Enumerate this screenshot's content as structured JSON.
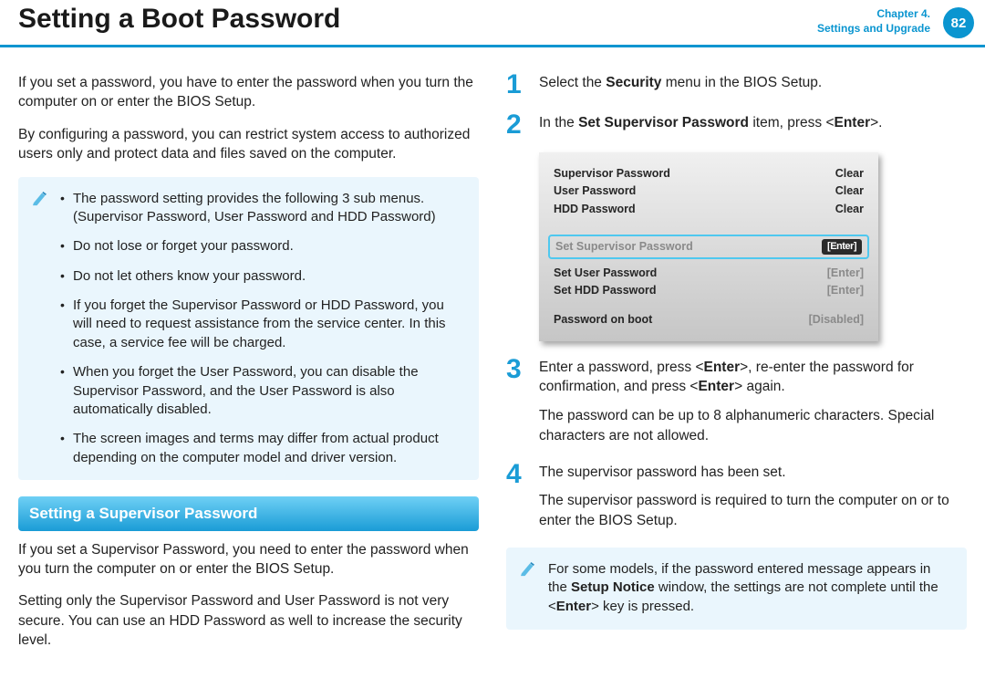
{
  "header": {
    "title": "Setting a Boot Password",
    "chapter_line1": "Chapter 4.",
    "chapter_line2": "Settings and Upgrade",
    "page_number": "82"
  },
  "left": {
    "p1": "If you set a password, you have to enter the password when you turn the computer on or enter the BIOS Setup.",
    "p2": "By configuring a password, you can restrict system access to authorized users only and protect data and files saved on the computer.",
    "notes": [
      "The password setting provides the following 3 sub menus. (Supervisor Password, User Password and HDD Password)",
      "Do not lose or forget your password.",
      "Do not let others know your password.",
      "If you forget the Supervisor Password or HDD Password, you will need to request assistance from the service center. In this case, a service fee will be charged.",
      "When you forget the User Password, you can disable the Supervisor Password, and the User Password is also automatically disabled.",
      "The screen images and terms may differ from actual product depending on the computer model and driver version."
    ],
    "section_title": "Setting a Supervisor Password",
    "p3": "If you set a Supervisor Password, you need to enter the password when you turn the computer on or enter the BIOS Setup.",
    "p4": "Setting only the Supervisor Password and User Password is not very secure. You can use an HDD Password as well to increase the security level."
  },
  "right": {
    "step1": {
      "num": "1",
      "pre": "Select the ",
      "bold": "Security",
      "post": " menu in the BIOS Setup."
    },
    "step2": {
      "num": "2",
      "pre": "In the ",
      "bold": "Set Supervisor Password",
      "mid": " item, press <",
      "enter": "Enter",
      "post": ">."
    },
    "bios": {
      "rows_top": [
        {
          "label": "Supervisor Password",
          "value": "Clear"
        },
        {
          "label": "User Password",
          "value": "Clear"
        },
        {
          "label": "HDD Password",
          "value": "Clear"
        }
      ],
      "highlight": {
        "label": "Set Supervisor Password",
        "value": "[Enter]"
      },
      "rows_mid": [
        {
          "label": "Set User Password",
          "value": "[Enter]"
        },
        {
          "label": "Set HDD Password",
          "value": "[Enter]"
        }
      ],
      "row_bottom": {
        "label": "Password on boot",
        "value": "[Disabled]"
      }
    },
    "step3": {
      "num": "3",
      "t1a": "Enter a password, press <",
      "t1b": "Enter",
      "t1c": ">, re-enter the password for confirmation, and press <",
      "t1d": "Enter",
      "t1e": "> again.",
      "t2": "The password can be up to 8 alphanumeric characters. Special characters are not allowed."
    },
    "step4": {
      "num": "4",
      "t1": "The supervisor password has been set.",
      "t2": "The supervisor password is required to turn the computer on or to enter the BIOS Setup."
    },
    "footnote": {
      "a": "For some models, if the password entered message appears in the ",
      "b": "Setup Notice",
      "c": " window, the settings are not complete until the <",
      "d": "Enter",
      "e": "> key is pressed."
    }
  }
}
